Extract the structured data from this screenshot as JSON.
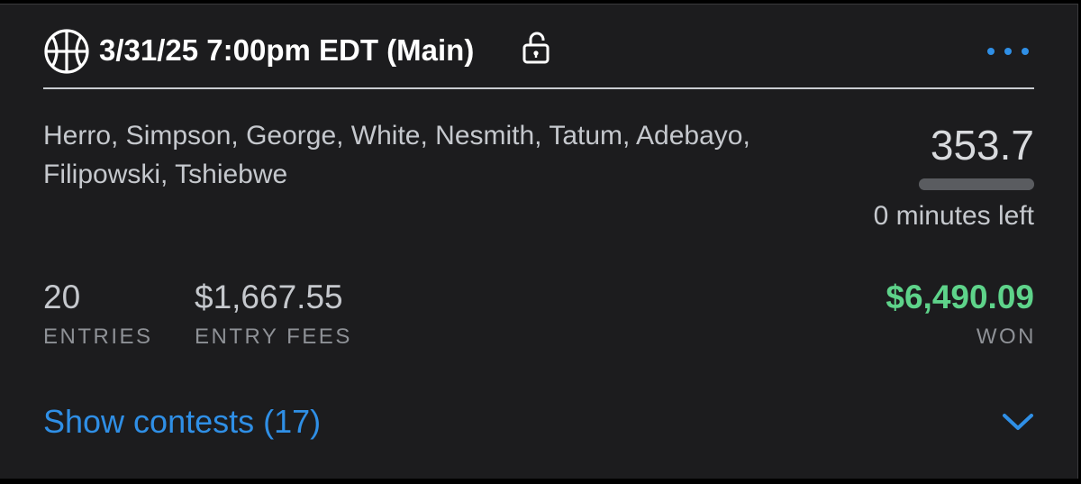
{
  "header": {
    "title": "3/31/25 7:00pm EDT (Main)",
    "sport_icon": "basketball-icon",
    "lock_icon": "unlock-icon",
    "more_icon": "more-dots-icon"
  },
  "lineup": {
    "players": "Herro, Simpson, George, White, Nesmith, Tatum, Adebayo, Filipowski, Tshiebwe",
    "score": "353.7",
    "progress_fraction": 1.0,
    "time_left": "0 minutes left"
  },
  "stats": {
    "entries": {
      "value": "20",
      "label": "ENTRIES"
    },
    "entry_fees": {
      "value": "$1,667.55",
      "label": "ENTRY FEES"
    },
    "won": {
      "value": "$6,490.09",
      "label": "WON"
    }
  },
  "footer": {
    "show_contests_label": "Show contests (17)",
    "expand_icon": "chevron-down-icon"
  },
  "colors": {
    "background": "#1c1c1e",
    "accent": "#2f8fe6",
    "won": "#5ed38a"
  }
}
